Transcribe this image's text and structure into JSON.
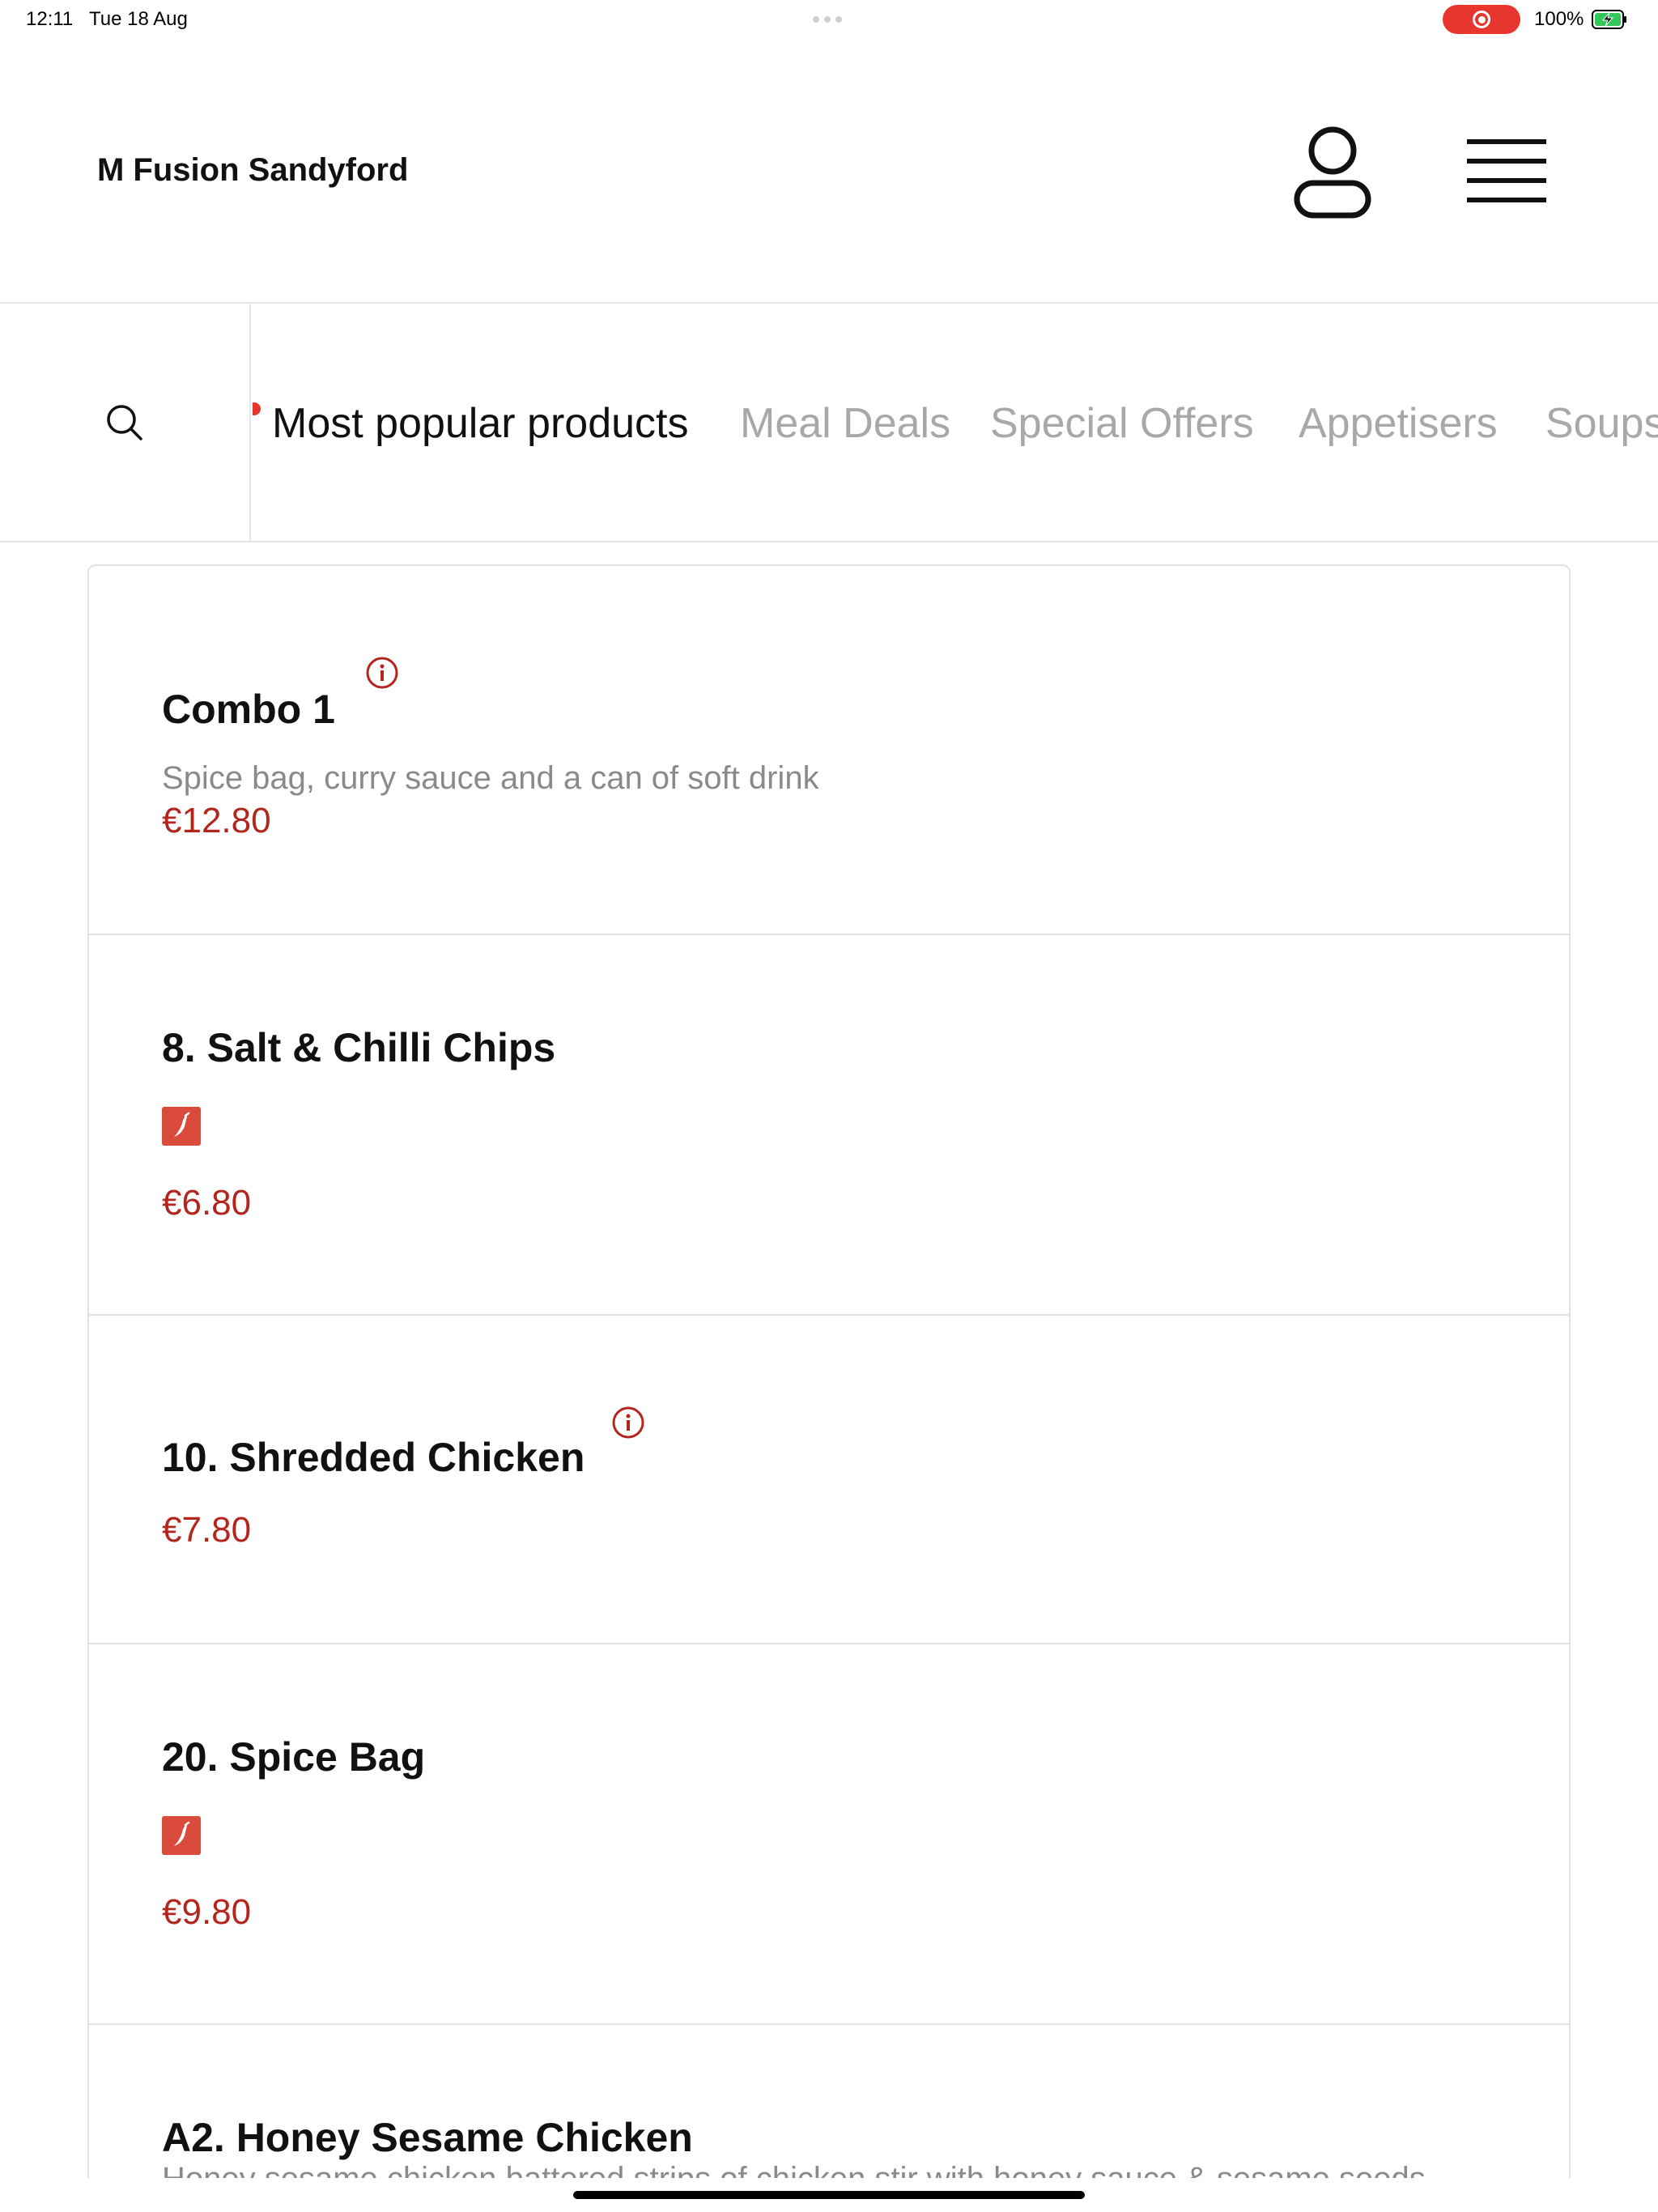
{
  "status_bar": {
    "time": "12:11",
    "date": "Tue 18 Aug",
    "battery": "100%",
    "recording_color": "#e8362e",
    "battery_charging_color": "#34c759"
  },
  "header": {
    "store_name": "M Fusion Sandyford",
    "account_icon": "person-outline-icon",
    "menu_icon": "hamburger-menu-icon"
  },
  "nav": {
    "search_icon": "search-icon",
    "tabs": [
      {
        "label": "Most popular products",
        "active": true
      },
      {
        "label": "Meal Deals",
        "active": false
      },
      {
        "label": "Special Offers",
        "active": false
      },
      {
        "label": "Appetisers",
        "active": false
      },
      {
        "label": "Soups",
        "active": false
      }
    ]
  },
  "products": [
    {
      "name": "Combo 1",
      "description": "Spice bag, curry sauce and a can of soft drink",
      "price": "€12.80",
      "info": true,
      "spicy": false
    },
    {
      "name": "8. Salt & Chilli Chips",
      "description": "",
      "price": "€6.80",
      "info": false,
      "spicy": true
    },
    {
      "name": "10. Shredded Chicken",
      "description": "",
      "price": "€7.80",
      "info": true,
      "spicy": false
    },
    {
      "name": "20. Spice Bag",
      "description": "",
      "price": "€9.80",
      "info": false,
      "spicy": true
    },
    {
      "name": "A2. Honey Sesame Chicken",
      "description": "Honey sesame chicken battered strips of chicken stir with honey sauce & sesame seeds",
      "price": "",
      "info": false,
      "spicy": false
    }
  ],
  "colors": {
    "price": "#b3261e",
    "chilli_badge": "#db4b3c",
    "active_tab": "#111111",
    "inactive_tab": "#a8a8a8"
  }
}
